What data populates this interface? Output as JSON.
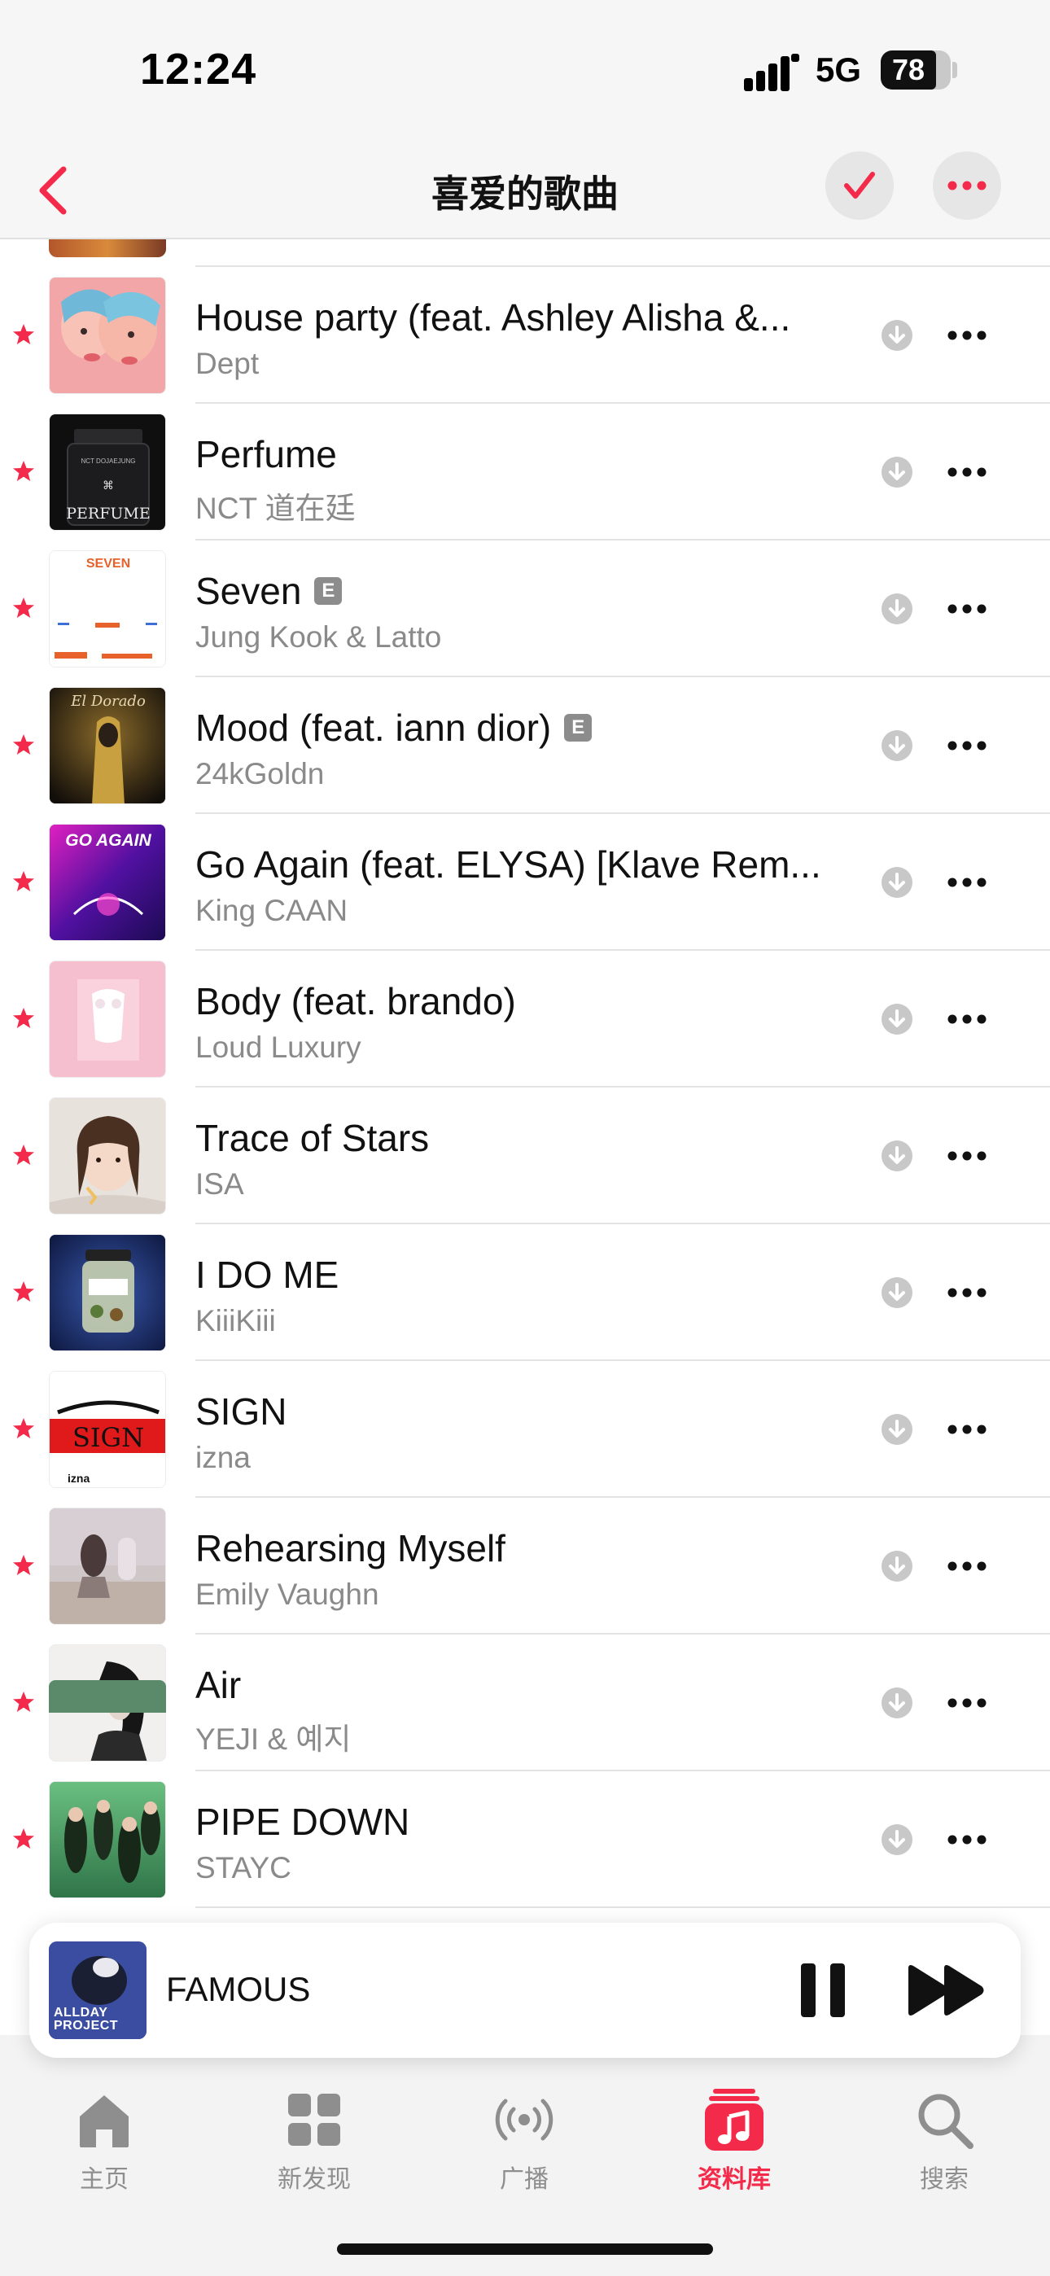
{
  "status_bar": {
    "time": "12:24",
    "network": "5G",
    "battery": "78"
  },
  "nav": {
    "title": "喜爱的歌曲"
  },
  "colors": {
    "accent": "#f42a4a",
    "secondary_text": "#8a8a8a",
    "explicit_badge": "#8c8c8c"
  },
  "songs": [
    {
      "title": "House party (feat. Ashley Alisha &...",
      "artist": "Dept",
      "explicit": false
    },
    {
      "title": "Perfume",
      "artist": "NCT 道在廷",
      "explicit": false
    },
    {
      "title": "Seven",
      "artist": "Jung Kook & Latto",
      "explicit": true
    },
    {
      "title": "Mood (feat. iann dior)",
      "artist": "24kGoldn",
      "explicit": true
    },
    {
      "title": "Go Again (feat. ELYSA) [Klave Rem...",
      "artist": "King CAAN",
      "explicit": false
    },
    {
      "title": "Body (feat. brando)",
      "artist": "Loud Luxury",
      "explicit": false
    },
    {
      "title": "Trace of Stars",
      "artist": "ISA",
      "explicit": false
    },
    {
      "title": "I DO ME",
      "artist": "KiiiKiii",
      "explicit": false
    },
    {
      "title": "SIGN",
      "artist": "izna",
      "explicit": false
    },
    {
      "title": "Rehearsing Myself",
      "artist": "Emily Vaughn",
      "explicit": false
    },
    {
      "title": "Air",
      "artist": "YEJI & 예지",
      "explicit": false
    },
    {
      "title": "PIPE DOWN",
      "artist": "STAYC",
      "explicit": false
    }
  ],
  "explicit_label": "E",
  "album_art_text": {
    "perfume": "PERFUME",
    "seven": "SEVEN",
    "mood": "El Dorado",
    "go_again": "GO AGAIN",
    "sign": "SIGN",
    "sign_sub": "izna",
    "mini_player": "ALLDAY PROJECT"
  },
  "mini_player": {
    "title": "FAMOUS"
  },
  "tabs": [
    {
      "label": "主页",
      "icon": "home-icon",
      "active": false
    },
    {
      "label": "新发现",
      "icon": "grid-icon",
      "active": false
    },
    {
      "label": "广播",
      "icon": "radio-icon",
      "active": false
    },
    {
      "label": "资料库",
      "icon": "music-library-icon",
      "active": true
    },
    {
      "label": "搜索",
      "icon": "search-icon",
      "active": false
    }
  ]
}
